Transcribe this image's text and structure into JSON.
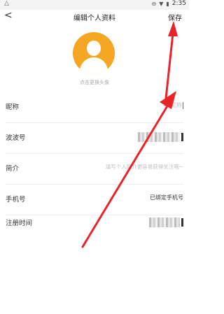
{
  "status_bar": {
    "left_text": "△",
    "time": "2:35"
  },
  "header": {
    "back_glyph": "<",
    "title": "编辑个人资料",
    "save_label": "保存"
  },
  "avatar": {
    "hint": "点击更换头像"
  },
  "fields": [
    {
      "label": "昵称",
      "value": "",
      "placeholder": "昵称"
    },
    {
      "label": "波波号",
      "value": ""
    },
    {
      "label": "简介",
      "value": "",
      "placeholder": "填写个人简介更容易获得关注哦~"
    },
    {
      "label": "手机号",
      "value": "已绑定手机号"
    },
    {
      "label": "注册时间",
      "value": ""
    }
  ],
  "colors": {
    "annotation_arrow": "#e8242a",
    "avatar_bg": "#f5a623"
  }
}
